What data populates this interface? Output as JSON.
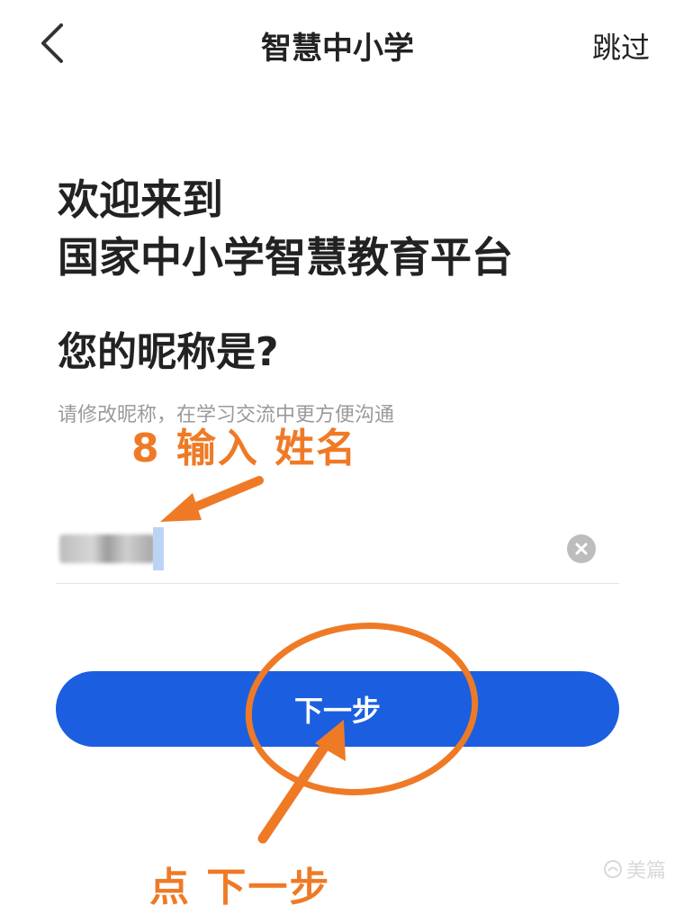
{
  "nav": {
    "back_icon": "chevron-left-icon",
    "title": "智慧中小学",
    "skip_label": "跳过"
  },
  "welcome": {
    "line1": "欢迎来到",
    "line2": "国家中小学智慧教育平台"
  },
  "question": "您的昵称是?",
  "hint": "请修改昵称，在学习交流中更方便沟通",
  "nickname_input": {
    "value": "",
    "clear_icon": "clear-circle-icon"
  },
  "next_button": {
    "label": "下一步"
  },
  "annotations": {
    "top": "8 输入 姓名",
    "bottom": "点 下一步"
  },
  "watermark": "美篇",
  "colors": {
    "primary_button": "#1b5fe0",
    "annotation": "#ef7a26",
    "hint_text": "#9a9a9a"
  }
}
